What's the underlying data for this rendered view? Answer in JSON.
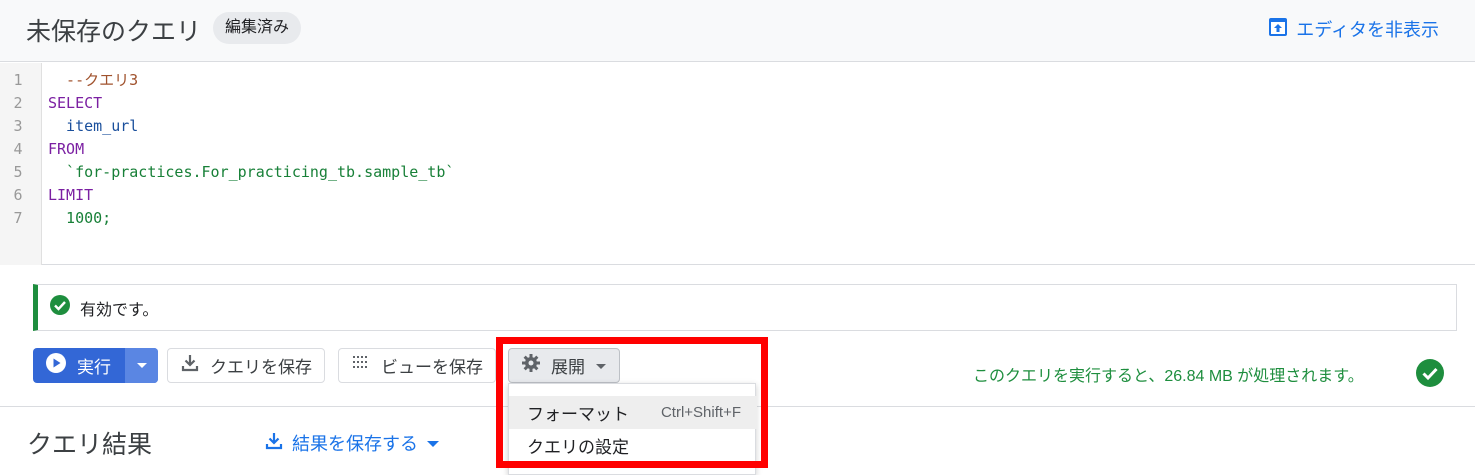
{
  "header": {
    "title": "未保存のクエリ",
    "badge": "編集済み",
    "hide_editor_label": "エディタを非表示"
  },
  "editor": {
    "lines": [
      {
        "num": "1",
        "text": "  --クエリ3",
        "kind": "comment"
      },
      {
        "num": "2",
        "text": "SELECT",
        "kind": "keyword"
      },
      {
        "num": "3",
        "text": "  item_url",
        "kind": "identifier"
      },
      {
        "num": "4",
        "text": "FROM",
        "kind": "keyword"
      },
      {
        "num": "5",
        "text": "  `for-practices.For_practicing_tb.sample_tb`",
        "kind": "string"
      },
      {
        "num": "6",
        "text": "LIMIT",
        "kind": "keyword"
      },
      {
        "num": "7",
        "text": "  1000;",
        "kind": "number"
      }
    ]
  },
  "validation": {
    "message": "有効です。"
  },
  "toolbar": {
    "run_label": "実行",
    "save_query_label": "クエリを保存",
    "save_view_label": "ビューを保存",
    "expand_label": "展開",
    "cost_text": "このクエリを実行すると、26.84 MB が処理されます。"
  },
  "menu": {
    "items": [
      {
        "label": "フォーマット",
        "shortcut": "Ctrl+Shift+F"
      },
      {
        "label": "クエリの設定",
        "shortcut": ""
      }
    ]
  },
  "results": {
    "title": "クエリ結果",
    "save_results_label": "結果を保存する"
  },
  "colors": {
    "accent": "#1a73e8",
    "run_button": "#3367d6",
    "success": "#1e8e3e",
    "highlight_box": "#ff0000"
  }
}
